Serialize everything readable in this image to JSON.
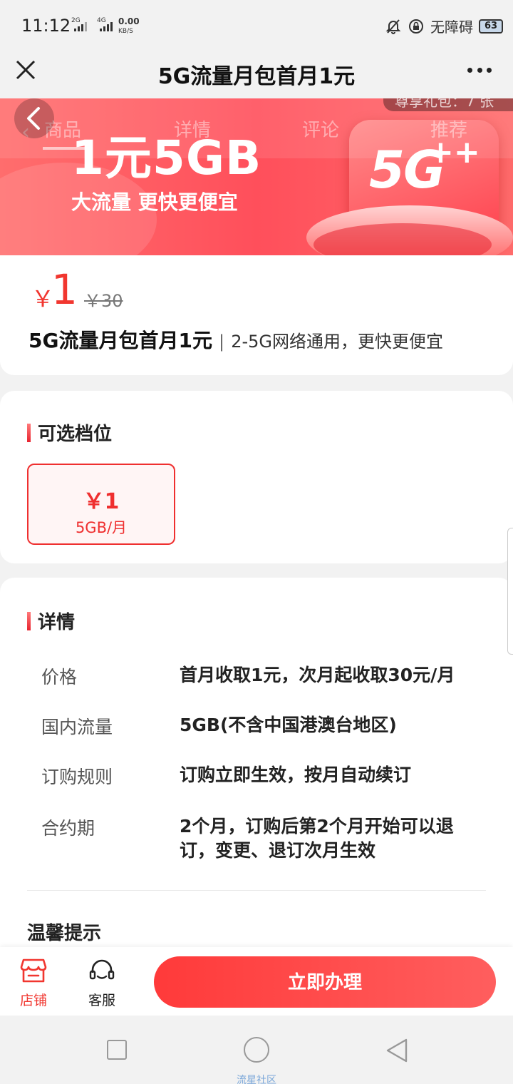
{
  "status_bar": {
    "time": "11:12",
    "net1": "2G",
    "net2": "4G",
    "speed_value": "0.00",
    "speed_unit": "KB/S",
    "accessibility": "无障碍",
    "battery": "63",
    "icons": [
      "mute-bell-icon",
      "lock-rotation-icon"
    ]
  },
  "titlebar": {
    "title": "5G流量月包首月1元",
    "close_icon": "close-icon",
    "more_icon": "more-dots-icon"
  },
  "banner": {
    "notice": "尊享礼包：7 张",
    "big_text": "1元5GB",
    "sub_text": "大流量 更快更便宜",
    "logo_text": "5G",
    "logo_plus": "++",
    "tabs": [
      "商品",
      "详情",
      "评论",
      "推荐"
    ],
    "back_icon": "chevron-left-icon"
  },
  "price": {
    "currency": "￥",
    "current": "1",
    "original": "￥30",
    "product_name": "5G流量月包首月1元",
    "separator": "|",
    "product_desc": "2-5G网络通用，更快更便宜"
  },
  "options": {
    "title": "可选档位",
    "items": [
      {
        "price": "￥1",
        "spec": "5GB/月",
        "selected": true
      }
    ]
  },
  "details": {
    "title": "详情",
    "rows": [
      {
        "label": "价格",
        "value": "首月收取1元，次月起收取30元/月"
      },
      {
        "label": "国内流量",
        "value": "5GB(不含中国港澳台地区)"
      },
      {
        "label": "订购规则",
        "value": "订购立即生效，按月自动续订"
      },
      {
        "label": "合约期",
        "value": "2个月，订购后第2个月开始可以退订，变更、退订次月生效"
      }
    ],
    "tips_title": "温馨提示"
  },
  "action_bar": {
    "shop_label": "店铺",
    "service_label": "客服",
    "apply_label": "立即办理",
    "accent_color": "#ff4040"
  },
  "system_nav": {
    "caption": "流星社区"
  }
}
